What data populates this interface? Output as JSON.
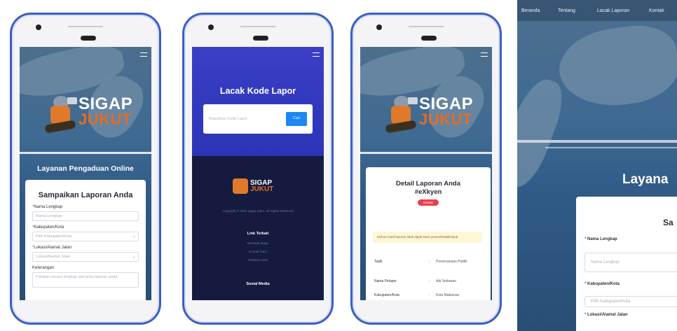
{
  "phone1": {
    "brand_top": "SIGAP",
    "brand_bottom": "JUKUT",
    "tagline": "Layanan Pengaduan Online",
    "form_title": "Sampaikan Laporan Anda",
    "fields": [
      {
        "label": "Nama Lengkap",
        "required": true,
        "placeholder": "Nama Lengkap"
      },
      {
        "label": "Kabupaten/Kota",
        "required": true,
        "placeholder": "Pilih Kabupaten/Kota"
      },
      {
        "label": "Lokasi/Alamat Jalan",
        "required": true,
        "placeholder": "Lokasi/Alamat Jalan"
      },
      {
        "label": "Keterangan",
        "required": false,
        "placeholder": "Tuliskan secara lengkap dan jelas laporan anda"
      }
    ]
  },
  "phone2": {
    "title": "Lacak Kode Lapor",
    "input_placeholder": "Masukkan Kode Lapor",
    "button_label": "Cari",
    "brand_top": "SIGAP",
    "brand_bottom": "JUKUT",
    "copyright": "Copyright © 2020 Sigap Jukut. All Rights Reserved",
    "section1_title": "Link Terkait",
    "links": [
      "Beranda Sigap",
      "Kontak Kami",
      "Tentang Jukut"
    ],
    "section2_title": "Sosial Media"
  },
  "phone3": {
    "brand_top": "SIGAP",
    "brand_bottom": "JUKUT",
    "title_line1": "Detail Laporan Anda",
    "title_line2": "#eXkyen",
    "status_badge": "Ditolak",
    "notice": "Mohon maaf laporan tidak dapat kami proses/tindaklanjuti",
    "rows": [
      {
        "key": "Topik",
        "value": "Perencanaan Publik"
      },
      {
        "key": "Nama Pelapor",
        "value": "Adi Setiawan"
      },
      {
        "key": "Kabupaten/Kota",
        "value": "Kota Makassar"
      }
    ]
  },
  "panel": {
    "nav": [
      "Beranda",
      "Tentang",
      "Lacak Laporan",
      "Kontak"
    ],
    "tagline_partial": "Layana",
    "card_title_partial": "Sa",
    "fields": [
      {
        "label": "Nama Lengkap",
        "placeholder": "Nama Lengkap"
      },
      {
        "label": "Kabupaten/Kota",
        "placeholder": "Pilih Kabupaten/Kota"
      },
      {
        "label": "Lokasi/Alamat Jalan",
        "placeholder": ""
      }
    ]
  },
  "colors": {
    "frame": "#3a5fc4",
    "accent_orange": "#e36d24",
    "button_blue": "#1e86f5",
    "dark_footer": "#141b3f",
    "badge_red": "#e8414b"
  }
}
